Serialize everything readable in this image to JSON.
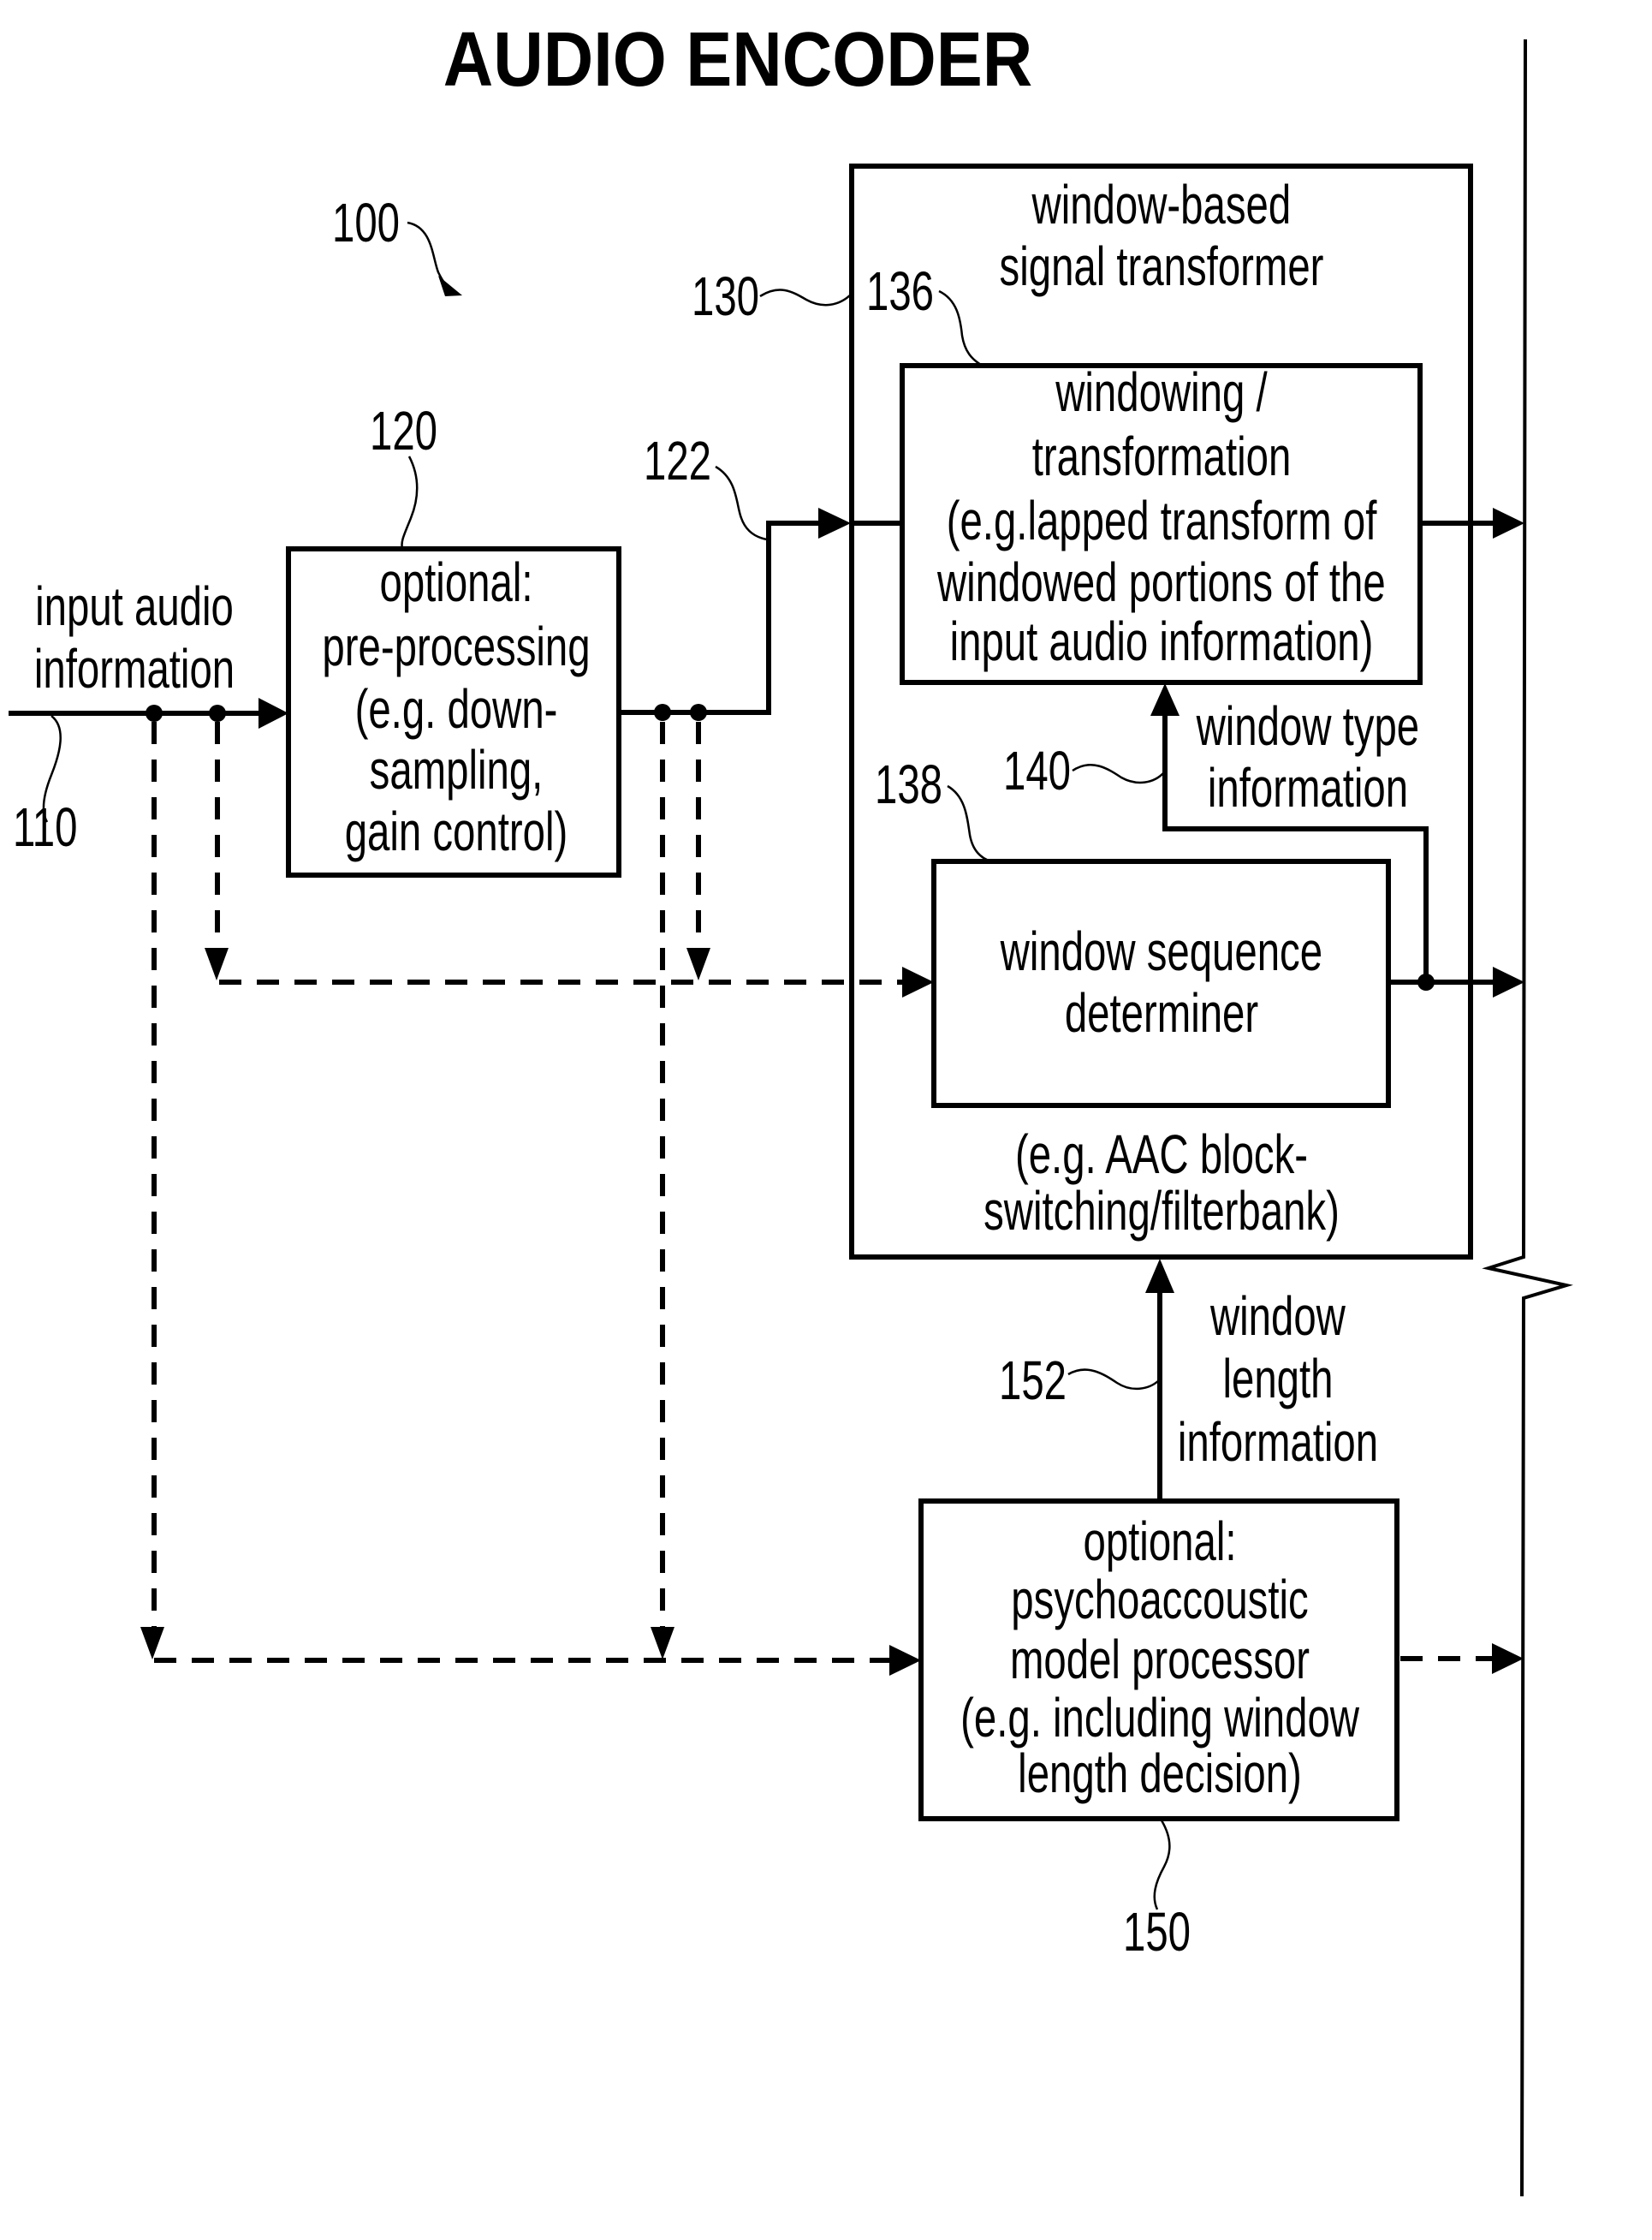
{
  "title": "AUDIO ENCODER",
  "refs": {
    "encoder": "100",
    "input": "110",
    "preprocessor": "120",
    "preprocessed_signal": "122",
    "transformer": "130",
    "windowing": "136",
    "sequence_determiner": "138",
    "window_type_info": "140",
    "psychoacoustic": "150",
    "window_length_info": "152"
  },
  "input_label": [
    "input audio",
    "information"
  ],
  "preprocessing_block": {
    "lines": [
      "optional:",
      "pre-processing",
      "(e.g. down-",
      "sampling,",
      "gain control)"
    ]
  },
  "transformer_block": {
    "title_lines": [
      "window-based",
      "signal transformer"
    ],
    "footer_lines": [
      "(e.g. AAC block-",
      "switching/filterbank)"
    ]
  },
  "windowing_block": {
    "lines": [
      "windowing /",
      "transformation",
      "(e.g.lapped transform of",
      "windowed portions of the",
      "input audio information)"
    ]
  },
  "window_type_label": [
    "window type",
    "information"
  ],
  "sequence_block": {
    "lines": [
      "window sequence",
      "determiner"
    ]
  },
  "window_length_label": [
    "window",
    "length",
    "information"
  ],
  "psychoacoustic_block": {
    "lines": [
      "optional:",
      "psychoaccoustic",
      "model processor",
      "(e.g. including window",
      "length decision)"
    ]
  }
}
